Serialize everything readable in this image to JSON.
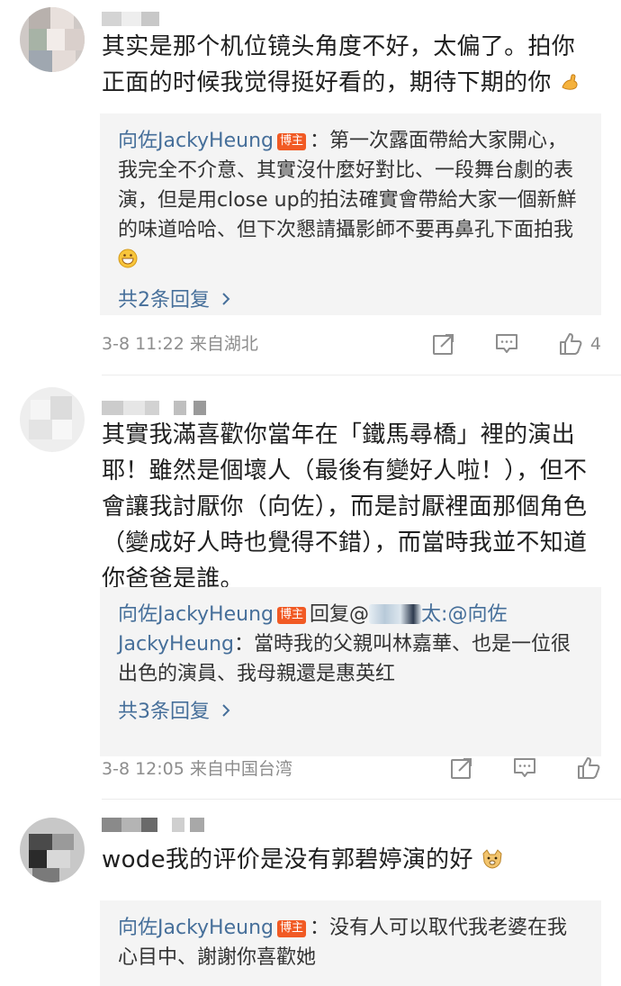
{
  "comments": [
    {
      "text": "其实是那个机位镜头角度不好，太偏了。拍你正面的时候我觉得挺好看的，期待下期的你",
      "emoji": "flexed-biceps",
      "reply": {
        "author": "向佐JackyHeung",
        "badge": "博主",
        "text": "第一次露面帶給大家開心，我完全不介意、其實沒什麼好對比、一段舞台劇的表演，但是用close up的拍法確實會帶給大家一個新鮮的味道哈哈、但下次懇請攝影師不要再鼻孔下面拍我",
        "emoji": "grinning-face",
        "more": "共2条回复"
      },
      "meta": "3-8 11:22 来自湖北",
      "likes": "4"
    },
    {
      "text": "其實我滿喜歡你當年在「鐵馬尋橋」裡的演出耶！雖然是個壞人（最後有變好人啦！），但不會讓我討厭你（向佐），而是討厭裡面那個角色（變成好人時也覺得不錯），而當時我並不知道你爸爸是誰。",
      "reply": {
        "author": "向佐JackyHeung",
        "badge": "博主",
        "reply_word": "回复@",
        "mention_suffix": "太:",
        "mention2": "@向佐JackyHeung",
        "text": "當時我的父親叫林嘉華、也是一位很出色的演員、我母親還是惠英红",
        "more": "共3条回复"
      },
      "meta": "3-8 12:05 来自中国台湾",
      "likes": ""
    },
    {
      "text": "wode我的评价是没有郭碧婷演的好",
      "emoji": "doge",
      "reply": {
        "author": "向佐JackyHeung",
        "badge": "博主",
        "text": "没有人可以取代我老婆在我心目中、謝謝你喜歡她"
      }
    }
  ],
  "icons": {
    "share": "share-icon",
    "comment": "comment-icon",
    "like": "thumbs-up-icon",
    "more": "chevron-right-icon"
  },
  "colors": {
    "link": "#466f9a",
    "badge": "#f15a24",
    "meta": "#8d8d8d",
    "reply_bg": "#f4f4f4"
  }
}
